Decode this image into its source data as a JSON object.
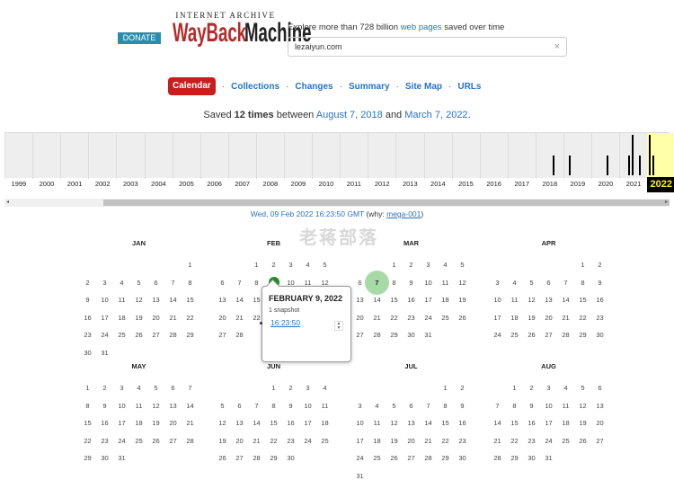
{
  "header": {
    "donate_label": "DONATE",
    "logo_top": "INTERNET ARCHIVE",
    "logo_wayback": "WaybackMachine",
    "tagline_prefix": "Explore more than 728 billion ",
    "tagline_link": "web pages",
    "tagline_suffix": " saved over time",
    "url_value": "lezaiyun.com",
    "clear_icon": "×"
  },
  "tabs": [
    "Calendar",
    "Collections",
    "Changes",
    "Summary",
    "Site Map",
    "URLs"
  ],
  "active_tab": "Calendar",
  "summary": {
    "prefix": "Saved ",
    "count": "12 times",
    "middle": " between ",
    "first": "August 7, 2018",
    "and": " and ",
    "last": "March 7, 2022",
    "end": "."
  },
  "timeline": {
    "years": [
      "1999",
      "2000",
      "2001",
      "2002",
      "2003",
      "2004",
      "2005",
      "2006",
      "2007",
      "2008",
      "2009",
      "2010",
      "2011",
      "2012",
      "2013",
      "2014",
      "2015",
      "2016",
      "2017",
      "2018",
      "2019",
      "2020",
      "2021"
    ],
    "current_year": "2022",
    "snapshot_bars": [
      {
        "year": 2018,
        "pos": 0.6,
        "level": 0.5
      },
      {
        "year": 2019,
        "pos": 0.2,
        "level": 0.5
      },
      {
        "year": 2020,
        "pos": 0.55,
        "level": 0.5
      },
      {
        "year": 2021,
        "pos": 0.3,
        "level": 0.5
      },
      {
        "year": 2021,
        "pos": 0.45,
        "level": 1.0
      },
      {
        "year": 2021,
        "pos": 0.7,
        "level": 0.5
      },
      {
        "year": 2022,
        "pos": 0.05,
        "level": 1.0
      },
      {
        "year": 2022,
        "pos": 0.18,
        "level": 0.5
      }
    ],
    "scroll_left": "◂",
    "scroll_right": "▸"
  },
  "snapshot_info": {
    "time": "Wed, 09 Feb 2022 16:23:50 GMT",
    "why_prefix": " (why: ",
    "why_link": "mega-001",
    "why_suffix": ")"
  },
  "watermark": "老蒋部落",
  "months": [
    {
      "name": "JAN",
      "start": 6,
      "days": 31
    },
    {
      "name": "FEB",
      "start": 2,
      "days": 28
    },
    {
      "name": "MAR",
      "start": 2,
      "days": 31
    },
    {
      "name": "APR",
      "start": 5,
      "days": 30
    },
    {
      "name": "MAY",
      "start": 0,
      "days": 31
    },
    {
      "name": "JUN",
      "start": 3,
      "days": 30
    },
    {
      "name": "JUL",
      "start": 5,
      "days": 31
    },
    {
      "name": "AUG",
      "start": 1,
      "days": 31
    }
  ],
  "highlights": {
    "FEB": {
      "day": 9,
      "style": "small"
    },
    "MAR": {
      "day": 7,
      "style": "big"
    }
  },
  "popup": {
    "date": "FEBRUARY 9, 2022",
    "count": "1 snapshot",
    "time_link": "16:23:50",
    "spin_up": "▲",
    "spin_down": "▼"
  },
  "colors": {
    "accent_red": "#c81e1e",
    "link_blue": "#2a72c8",
    "snapshot_green": "#1f8e21",
    "current_year_bg": "#ffffa8"
  }
}
